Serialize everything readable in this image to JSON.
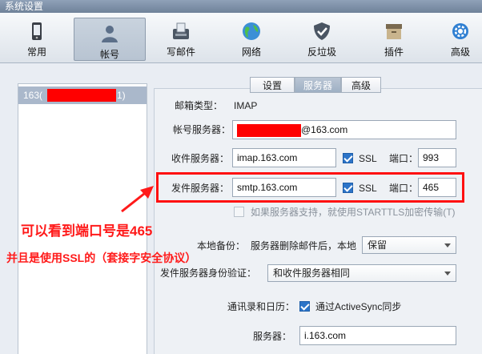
{
  "window": {
    "title": "系统设置"
  },
  "toolbar": {
    "items": [
      {
        "label": "常用",
        "icon": "phone-icon"
      },
      {
        "label": "帐号",
        "icon": "user-icon"
      },
      {
        "label": "写邮件",
        "icon": "compose-icon"
      },
      {
        "label": "网络",
        "icon": "globe-icon"
      },
      {
        "label": "反垃圾",
        "icon": "shield-icon"
      },
      {
        "label": "插件",
        "icon": "package-icon"
      },
      {
        "label": "高级",
        "icon": "gear-icon"
      }
    ],
    "active": "帐号"
  },
  "accounts": {
    "prefix": "163(",
    "suffix": "1)"
  },
  "tabs": {
    "settings": "设置",
    "server": "服务器",
    "advanced": "高级",
    "selected": "服务器"
  },
  "server": {
    "mailbox_type_label": "邮箱类型：",
    "mailbox_type_value": "IMAP",
    "account_server_label": "帐号服务器：",
    "account_server_value": "@163.com",
    "incoming_label": "收件服务器：",
    "incoming_value": "imap.163.com",
    "incoming_ssl": "SSL",
    "incoming_port_label": "端口：",
    "incoming_port": "993",
    "outgoing_label": "发件服务器：",
    "outgoing_value": "smtp.163.com",
    "outgoing_ssl": "SSL",
    "outgoing_port_label": "端口：",
    "outgoing_port": "465",
    "starttls_label": "如果服务器支持，就使用STARTTLS加密传输(T)",
    "backup_label": "本地备份：",
    "backup_desc": "服务器删除邮件后，本地",
    "backup_value": "保留",
    "auth_label": "发件服务器身份验证：",
    "auth_value": "和收件服务器相同",
    "contacts_label": "通讯录和日历：",
    "activesync_label": "通过ActiveSync同步",
    "server_label": "服务器：",
    "server_value": "i.163.com"
  },
  "annotation": {
    "line1": "可以看到端口号是465",
    "line2": "并且是使用SSL的（套接字安全协议）"
  },
  "colors": {
    "annotation": "#ff1a1a",
    "highlight_box": "#ff1010",
    "checkbox": "#2c74c8"
  }
}
